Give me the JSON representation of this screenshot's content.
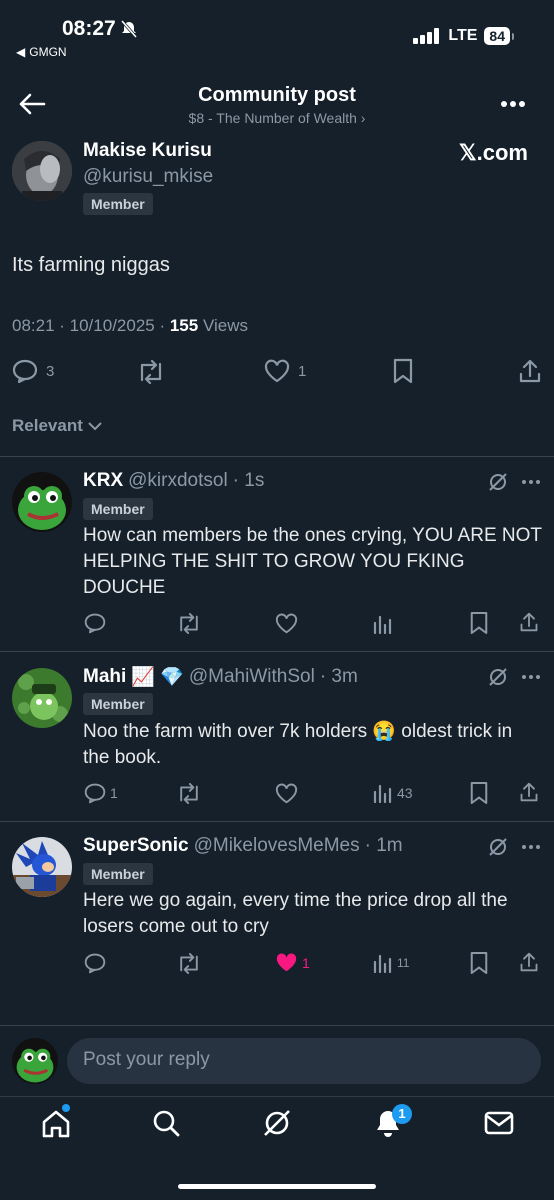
{
  "status_bar": {
    "time": "08:27",
    "back_app": "GMGN",
    "network": "LTE",
    "battery": "84"
  },
  "header": {
    "title": "Community post",
    "subtitle": "$8 - The Number of Wealth ›"
  },
  "post": {
    "author_name": "Makise Kurisu",
    "author_handle": "@kurisu_mkise",
    "badge": "Member",
    "brand": "𝕏.com",
    "text": "Its farming niggas",
    "time": "08:21 · 10/10/2025 · ",
    "views_count": "155",
    "views_label": " Views",
    "replies": "3",
    "likes": "1"
  },
  "sort_label": "Relevant",
  "comments": [
    {
      "name": "KRX",
      "handle": "@kirxdotsol",
      "time": "· 1s",
      "badge": "Member",
      "text": "How can members be the ones crying, YOU ARE NOT HELPING THE SHIT TO GROW YOU FKING DOUCHE",
      "replies": "",
      "likes": "",
      "views": ""
    },
    {
      "name": "Mahi",
      "emoji": "📈 💎",
      "handle": "@MahiWithSol",
      "time": "· 3m",
      "badge": "Member",
      "text": "Noo the farm with over 7k holders 😭 oldest trick in the book.",
      "replies": "1",
      "likes": "",
      "views": "43"
    },
    {
      "name": "SuperSonic",
      "handle": "@MikelovesMeMes",
      "time": "· 1m",
      "badge": "Member",
      "text": "Here we go again, every time the price drop all the losers come out to cry",
      "replies": "",
      "likes": "1",
      "views": "11"
    }
  ],
  "reply_placeholder": "Post your reply",
  "nav": {
    "notifications_count": "1"
  },
  "colors": {
    "background": "#15202b",
    "like_active": "#f91880",
    "accent": "#1d9bf0"
  }
}
